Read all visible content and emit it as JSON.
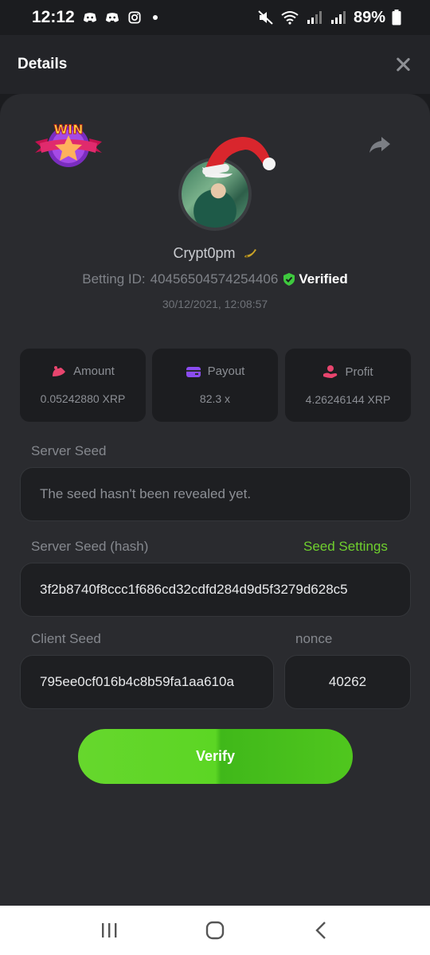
{
  "status_bar": {
    "time": "12:12",
    "battery": "89%"
  },
  "header": {
    "title": "Details",
    "close_icon": "close-icon"
  },
  "user": {
    "name": "Crypt0pm",
    "betting_id_label": "Betting ID:",
    "betting_id": "40456504574254406",
    "verified_label": "Verified",
    "timestamp": "30/12/2021, 12:08:57"
  },
  "badge": {
    "text": "WIN"
  },
  "stats": [
    {
      "label": "Amount",
      "value": "0.05242880 XRP",
      "icon": "amount-icon",
      "color": "#e8456e"
    },
    {
      "label": "Payout",
      "value": "82.3 x",
      "icon": "payout-icon",
      "color": "#8b4cf0"
    },
    {
      "label": "Profit",
      "value": "4.26246144 XRP",
      "icon": "profit-icon",
      "color": "#e8456e"
    }
  ],
  "server_seed": {
    "label": "Server Seed",
    "value": "The seed hasn't been revealed yet."
  },
  "server_seed_hash": {
    "label": "Server Seed (hash)",
    "settings_link": "Seed Settings",
    "value": "3f2b8740f8ccc1f686cd32cdfd284d9d5f3279d628c5"
  },
  "client_seed": {
    "label": "Client Seed",
    "value": "795ee0cf016b4c8b59fa1aa610a"
  },
  "nonce": {
    "label": "nonce",
    "value": "40262"
  },
  "verify_button": "Verify",
  "colors": {
    "accent_green": "#5cd624",
    "verified_green": "#3ec93e",
    "link_green": "#6fcf2e"
  }
}
